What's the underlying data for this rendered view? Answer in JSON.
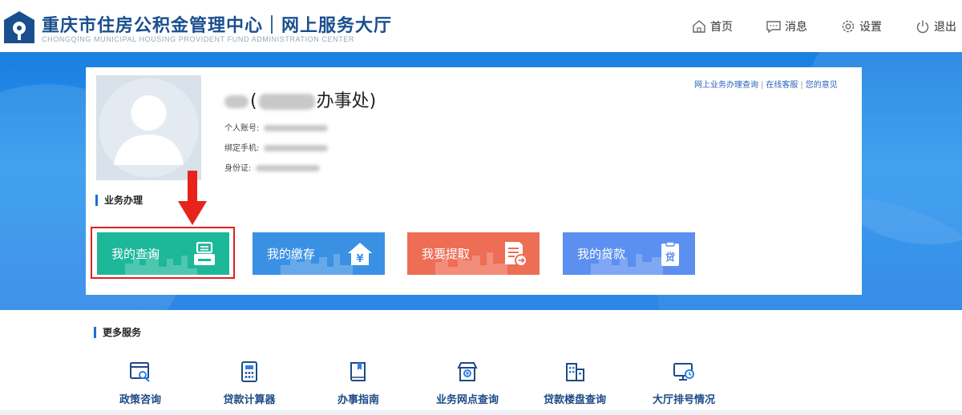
{
  "header": {
    "title": "重庆市住房公积金管理中心｜网上服务大厅",
    "subtitle": "CHONGQING MUNICIPAL HOUSING PROVIDENT FUND ADMINISTRATION CENTER",
    "nav": [
      {
        "label": "首页",
        "icon": "home-icon"
      },
      {
        "label": "消息",
        "icon": "message-icon"
      },
      {
        "label": "设置",
        "icon": "gear-icon"
      },
      {
        "label": "退出",
        "icon": "power-icon"
      }
    ]
  },
  "profile": {
    "name_suffix": "办事处)",
    "fields": [
      {
        "label": "个人账号:"
      },
      {
        "label": "绑定手机:"
      },
      {
        "label": "身份证:"
      }
    ],
    "quick_links": [
      "网上业务办理查询",
      "在线客服",
      "您的意见"
    ]
  },
  "business": {
    "section_title": "业务办理",
    "tiles": [
      {
        "label": "我的查询",
        "color": "#1db79a",
        "icon": "printer-icon"
      },
      {
        "label": "我的缴存",
        "color": "#3a91e4",
        "icon": "house-yen-icon"
      },
      {
        "label": "我要提取",
        "color": "#ee6d55",
        "icon": "document-withdraw-icon"
      },
      {
        "label": "我的贷款",
        "color": "#5b8ff0",
        "icon": "loan-clipboard-icon"
      }
    ]
  },
  "more_services": {
    "section_title": "更多服务",
    "items": [
      {
        "label": "政策咨询",
        "icon": "policy-browser-icon"
      },
      {
        "label": "贷款计算器",
        "icon": "calculator-icon"
      },
      {
        "label": "办事指南",
        "icon": "guide-book-icon"
      },
      {
        "label": "业务网点查询",
        "icon": "branch-store-icon"
      },
      {
        "label": "贷款楼盘查询",
        "icon": "building-icon"
      },
      {
        "label": "大厅排号情况",
        "icon": "queue-monitor-icon"
      }
    ]
  },
  "colors": {
    "brand": "#1a4f8f",
    "banner": "#2b8ae8",
    "highlight": "#e02020"
  }
}
